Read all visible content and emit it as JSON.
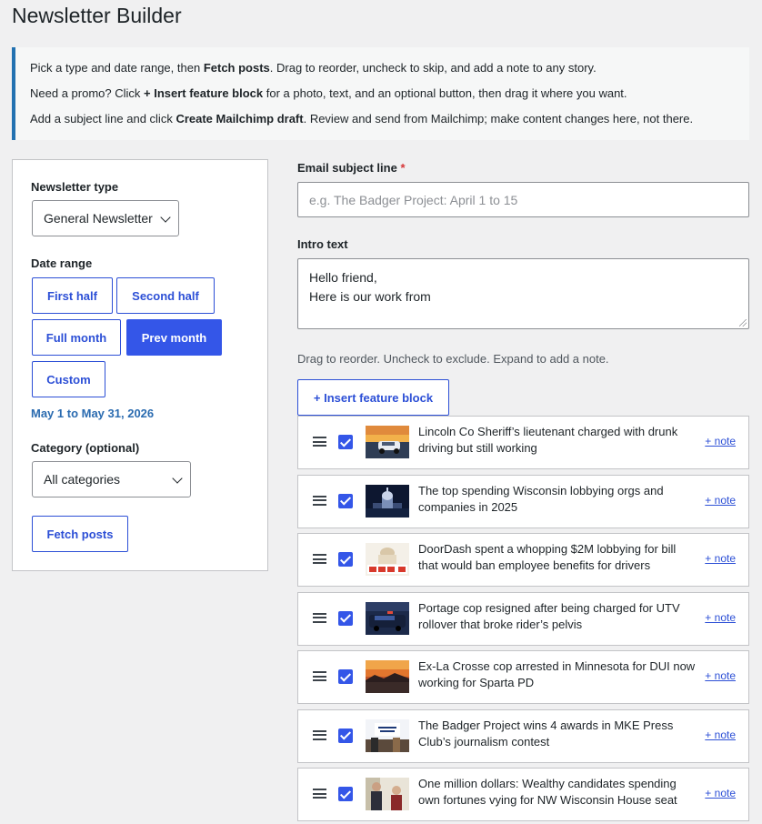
{
  "page_title": "Newsletter Builder",
  "notice": {
    "line1": {
      "a": "Pick a type and date range, then ",
      "b": "Fetch posts",
      "c": ". Drag to reorder, uncheck to skip, and add a note to any story."
    },
    "line2": {
      "a": "Need a promo? Click ",
      "b": "+ Insert feature block",
      "c": " for a photo, text, and an optional button, then drag it where you want."
    },
    "line3": {
      "a": "Add a subject line and click ",
      "b": "Create Mailchimp draft",
      "c": ". Review and send from Mailchimp; make content changes here, not there."
    }
  },
  "left": {
    "type_label": "Newsletter type",
    "type_value": "General Newsletter",
    "date_label": "Date range",
    "date_buttons": [
      "First half",
      "Second half",
      "Full month",
      "Prev month",
      "Custom"
    ],
    "active_date": "Prev month",
    "date_text": "May 1 to May 31, 2026",
    "category_label": "Category (optional)",
    "category_value": "All categories",
    "fetch_label": "Fetch posts"
  },
  "right": {
    "subject_label": "Email subject line",
    "subject_required": "*",
    "subject_placeholder": "e.g. The Badger Project: April 1 to 15",
    "subject_value": "",
    "intro_label": "Intro text",
    "intro_value": "Hello friend,\nHere is our work from",
    "hint": "Drag to reorder. Uncheck to exclude. Expand to add a note.",
    "insert_label": "+ Insert feature block",
    "note_label": "+ note"
  },
  "posts": [
    {
      "title": "Lincoln Co Sheriff’s lieutenant charged with drunk driving but still working",
      "checked": true,
      "thumb": "sunset-car"
    },
    {
      "title": "The top spending Wisconsin lobbying orgs and companies in 2025",
      "checked": true,
      "thumb": "capitol-night"
    },
    {
      "title": "DoorDash spent a whopping $2M lobbying for bill that would ban employee benefits for drivers",
      "checked": true,
      "thumb": "capitol-illustration"
    },
    {
      "title": "Portage cop resigned after being charged for UTV rollover that broke rider’s pelvis",
      "checked": true,
      "thumb": "police-car"
    },
    {
      "title": "Ex-La Crosse cop arrested in Minnesota for DUI now working for Sparta PD",
      "checked": true,
      "thumb": "sunset-lake"
    },
    {
      "title": "The Badger Project wins 4 awards in MKE Press Club’s journalism contest",
      "checked": true,
      "thumb": "awards-event"
    },
    {
      "title": "One million dollars: Wealthy candidates spending own fortunes vying for NW Wisconsin House seat",
      "checked": true,
      "thumb": "candidates"
    }
  ],
  "colors": {
    "accent": "#3456e8",
    "date_text": "#2a6bb0",
    "notice_border": "#2271b1"
  }
}
